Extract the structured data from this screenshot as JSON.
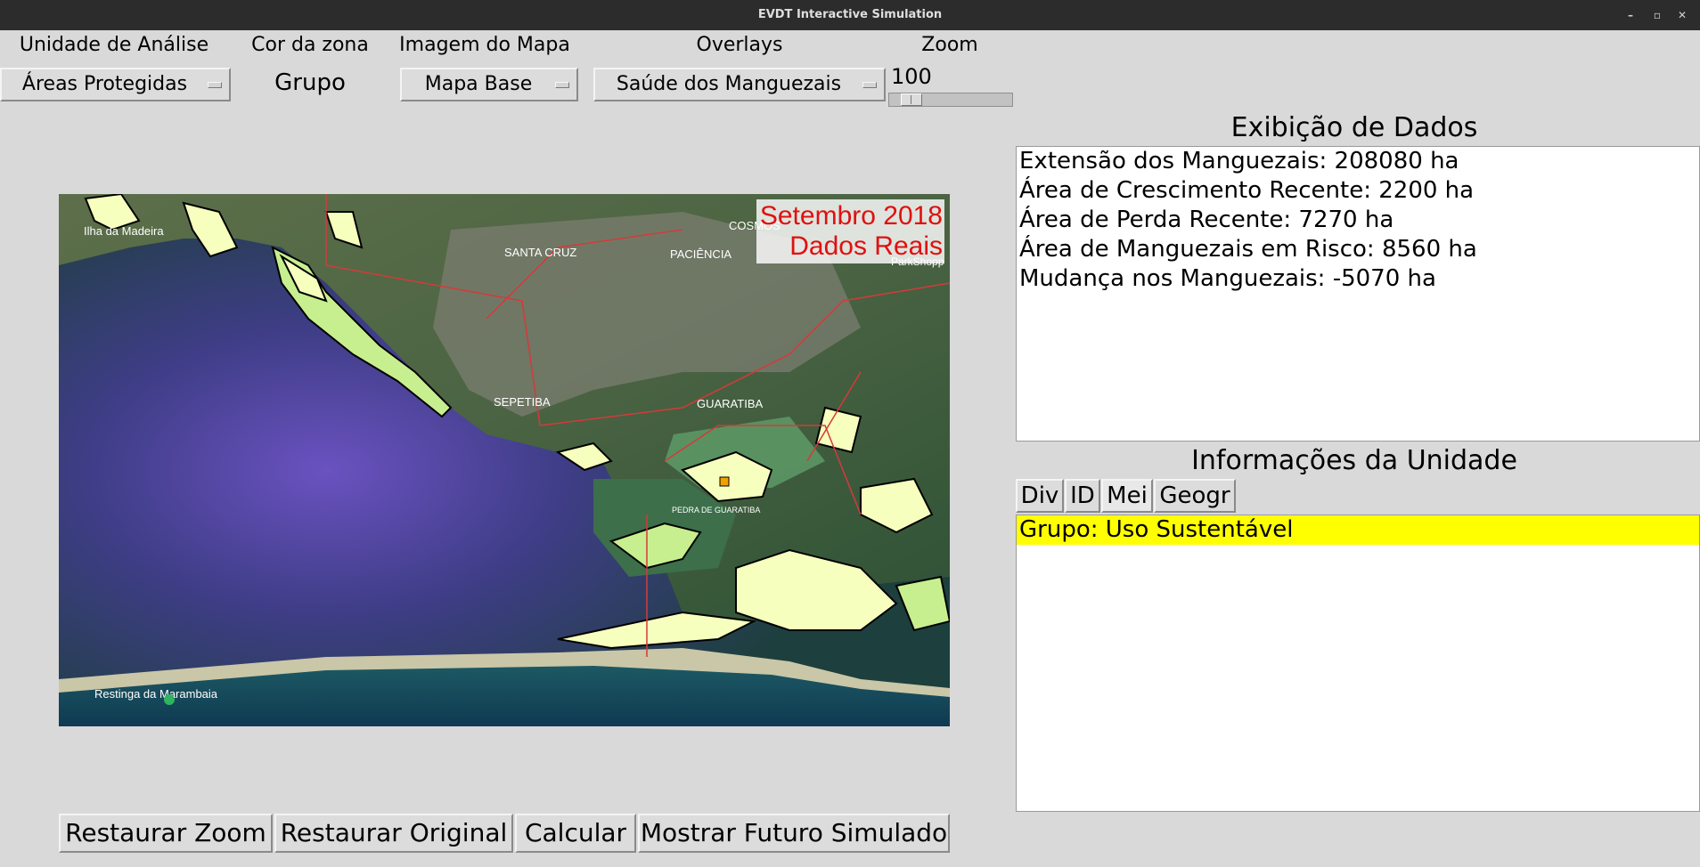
{
  "window": {
    "title": "EVDT Interactive Simulation"
  },
  "controls": {
    "unit_label": "Unidade de Análise",
    "unit_value": "Áreas Protegidas",
    "zone_color_label": "Cor da zona",
    "zone_color_value": "Grupo",
    "map_image_label": "Imagem do Mapa",
    "map_image_value": "Mapa Base",
    "overlays_label": "Overlays",
    "overlays_value": "Saúde dos Manguezais",
    "zoom_label": "Zoom",
    "zoom_value": "100"
  },
  "map": {
    "date_label": "Setembro 2018",
    "data_label": "Dados Reais",
    "place_labels": {
      "ilha": "Ilha da Madeira",
      "santa_cruz": "SANTA CRUZ",
      "paciencia": "PACIÊNCIA",
      "cosmos": "COSMOS",
      "sepetiba": "SEPETIBA",
      "guaratiba": "GUARATIBA",
      "pedra": "PEDRA DE GUARATIBA",
      "park": "ParkShopp",
      "restinga": "Restinga da Marambaia"
    },
    "colors": {
      "mangrove": "#f7ffbe",
      "mangrove_risk": "#c7ef8f",
      "boundary": "#d53a3a",
      "sea": "#5a45a8"
    }
  },
  "data_display": {
    "title": "Exibição de Dados",
    "lines": [
      "Extensão dos Manguezais: 208080 ha",
      "Área de Crescimento Recente: 2200 ha",
      "Área de Perda Recente: 7270 ha",
      "Área de Manguezais em Risco: 8560 ha",
      "Mudança nos Manguezais: -5070 ha"
    ]
  },
  "unit_info": {
    "title": "Informações da Unidade",
    "tabs": [
      "Div",
      "ID",
      "Mei",
      "Geogr"
    ],
    "selected_row": "Grupo: Uso Sustentável"
  },
  "buttons": {
    "reset_zoom": "Restaurar Zoom",
    "reset_original": "Restaurar Original",
    "calculate": "Calcular",
    "show_future": "Mostrar Futuro Simulado"
  }
}
